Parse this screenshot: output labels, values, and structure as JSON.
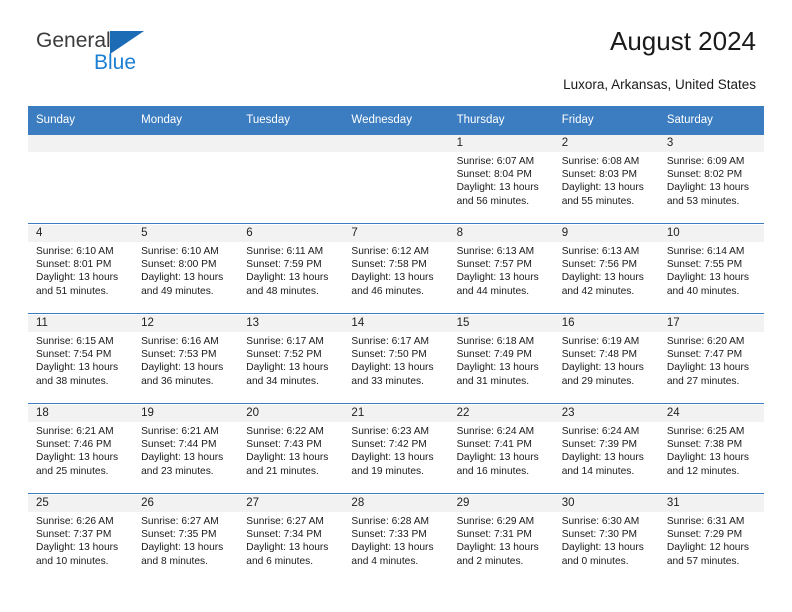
{
  "brand": {
    "name_part1": "General",
    "name_part2": "Blue",
    "logo_icon": "triangle-logo-icon"
  },
  "header": {
    "title": "August 2024",
    "subtitle": "Luxora, Arkansas, United States"
  },
  "calendar": {
    "weekday_headers": [
      "Sunday",
      "Monday",
      "Tuesday",
      "Wednesday",
      "Thursday",
      "Friday",
      "Saturday"
    ],
    "accent_color": "#3b7dc0",
    "daynum_bg": "#f2f2f2",
    "weeks": [
      [
        {
          "day": "",
          "blank": true
        },
        {
          "day": "",
          "blank": true
        },
        {
          "day": "",
          "blank": true
        },
        {
          "day": "",
          "blank": true
        },
        {
          "day": "1",
          "sunrise": "Sunrise: 6:07 AM",
          "sunset": "Sunset: 8:04 PM",
          "daylight": "Daylight: 13 hours and 56 minutes."
        },
        {
          "day": "2",
          "sunrise": "Sunrise: 6:08 AM",
          "sunset": "Sunset: 8:03 PM",
          "daylight": "Daylight: 13 hours and 55 minutes."
        },
        {
          "day": "3",
          "sunrise": "Sunrise: 6:09 AM",
          "sunset": "Sunset: 8:02 PM",
          "daylight": "Daylight: 13 hours and 53 minutes."
        }
      ],
      [
        {
          "day": "4",
          "sunrise": "Sunrise: 6:10 AM",
          "sunset": "Sunset: 8:01 PM",
          "daylight": "Daylight: 13 hours and 51 minutes."
        },
        {
          "day": "5",
          "sunrise": "Sunrise: 6:10 AM",
          "sunset": "Sunset: 8:00 PM",
          "daylight": "Daylight: 13 hours and 49 minutes."
        },
        {
          "day": "6",
          "sunrise": "Sunrise: 6:11 AM",
          "sunset": "Sunset: 7:59 PM",
          "daylight": "Daylight: 13 hours and 48 minutes."
        },
        {
          "day": "7",
          "sunrise": "Sunrise: 6:12 AM",
          "sunset": "Sunset: 7:58 PM",
          "daylight": "Daylight: 13 hours and 46 minutes."
        },
        {
          "day": "8",
          "sunrise": "Sunrise: 6:13 AM",
          "sunset": "Sunset: 7:57 PM",
          "daylight": "Daylight: 13 hours and 44 minutes."
        },
        {
          "day": "9",
          "sunrise": "Sunrise: 6:13 AM",
          "sunset": "Sunset: 7:56 PM",
          "daylight": "Daylight: 13 hours and 42 minutes."
        },
        {
          "day": "10",
          "sunrise": "Sunrise: 6:14 AM",
          "sunset": "Sunset: 7:55 PM",
          "daylight": "Daylight: 13 hours and 40 minutes."
        }
      ],
      [
        {
          "day": "11",
          "sunrise": "Sunrise: 6:15 AM",
          "sunset": "Sunset: 7:54 PM",
          "daylight": "Daylight: 13 hours and 38 minutes."
        },
        {
          "day": "12",
          "sunrise": "Sunrise: 6:16 AM",
          "sunset": "Sunset: 7:53 PM",
          "daylight": "Daylight: 13 hours and 36 minutes."
        },
        {
          "day": "13",
          "sunrise": "Sunrise: 6:17 AM",
          "sunset": "Sunset: 7:52 PM",
          "daylight": "Daylight: 13 hours and 34 minutes."
        },
        {
          "day": "14",
          "sunrise": "Sunrise: 6:17 AM",
          "sunset": "Sunset: 7:50 PM",
          "daylight": "Daylight: 13 hours and 33 minutes."
        },
        {
          "day": "15",
          "sunrise": "Sunrise: 6:18 AM",
          "sunset": "Sunset: 7:49 PM",
          "daylight": "Daylight: 13 hours and 31 minutes."
        },
        {
          "day": "16",
          "sunrise": "Sunrise: 6:19 AM",
          "sunset": "Sunset: 7:48 PM",
          "daylight": "Daylight: 13 hours and 29 minutes."
        },
        {
          "day": "17",
          "sunrise": "Sunrise: 6:20 AM",
          "sunset": "Sunset: 7:47 PM",
          "daylight": "Daylight: 13 hours and 27 minutes."
        }
      ],
      [
        {
          "day": "18",
          "sunrise": "Sunrise: 6:21 AM",
          "sunset": "Sunset: 7:46 PM",
          "daylight": "Daylight: 13 hours and 25 minutes."
        },
        {
          "day": "19",
          "sunrise": "Sunrise: 6:21 AM",
          "sunset": "Sunset: 7:44 PM",
          "daylight": "Daylight: 13 hours and 23 minutes."
        },
        {
          "day": "20",
          "sunrise": "Sunrise: 6:22 AM",
          "sunset": "Sunset: 7:43 PM",
          "daylight": "Daylight: 13 hours and 21 minutes."
        },
        {
          "day": "21",
          "sunrise": "Sunrise: 6:23 AM",
          "sunset": "Sunset: 7:42 PM",
          "daylight": "Daylight: 13 hours and 19 minutes."
        },
        {
          "day": "22",
          "sunrise": "Sunrise: 6:24 AM",
          "sunset": "Sunset: 7:41 PM",
          "daylight": "Daylight: 13 hours and 16 minutes."
        },
        {
          "day": "23",
          "sunrise": "Sunrise: 6:24 AM",
          "sunset": "Sunset: 7:39 PM",
          "daylight": "Daylight: 13 hours and 14 minutes."
        },
        {
          "day": "24",
          "sunrise": "Sunrise: 6:25 AM",
          "sunset": "Sunset: 7:38 PM",
          "daylight": "Daylight: 13 hours and 12 minutes."
        }
      ],
      [
        {
          "day": "25",
          "sunrise": "Sunrise: 6:26 AM",
          "sunset": "Sunset: 7:37 PM",
          "daylight": "Daylight: 13 hours and 10 minutes."
        },
        {
          "day": "26",
          "sunrise": "Sunrise: 6:27 AM",
          "sunset": "Sunset: 7:35 PM",
          "daylight": "Daylight: 13 hours and 8 minutes."
        },
        {
          "day": "27",
          "sunrise": "Sunrise: 6:27 AM",
          "sunset": "Sunset: 7:34 PM",
          "daylight": "Daylight: 13 hours and 6 minutes."
        },
        {
          "day": "28",
          "sunrise": "Sunrise: 6:28 AM",
          "sunset": "Sunset: 7:33 PM",
          "daylight": "Daylight: 13 hours and 4 minutes."
        },
        {
          "day": "29",
          "sunrise": "Sunrise: 6:29 AM",
          "sunset": "Sunset: 7:31 PM",
          "daylight": "Daylight: 13 hours and 2 minutes."
        },
        {
          "day": "30",
          "sunrise": "Sunrise: 6:30 AM",
          "sunset": "Sunset: 7:30 PM",
          "daylight": "Daylight: 13 hours and 0 minutes."
        },
        {
          "day": "31",
          "sunrise": "Sunrise: 6:31 AM",
          "sunset": "Sunset: 7:29 PM",
          "daylight": "Daylight: 12 hours and 57 minutes."
        }
      ]
    ]
  }
}
